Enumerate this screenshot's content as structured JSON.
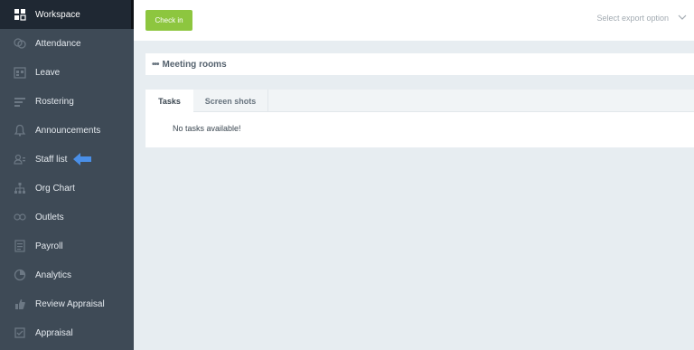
{
  "sidebar": {
    "items": [
      {
        "label": "Workspace",
        "icon": "workspace-icon",
        "active": true
      },
      {
        "label": "Attendance",
        "icon": "attendance-icon"
      },
      {
        "label": "Leave",
        "icon": "leave-icon"
      },
      {
        "label": "Rostering",
        "icon": "rostering-icon"
      },
      {
        "label": "Announcements",
        "icon": "bell-icon"
      },
      {
        "label": "Staff list",
        "icon": "staff-icon"
      },
      {
        "label": "Org Chart",
        "icon": "org-chart-icon"
      },
      {
        "label": "Outlets",
        "icon": "outlets-icon"
      },
      {
        "label": "Payroll",
        "icon": "payroll-icon"
      },
      {
        "label": "Analytics",
        "icon": "analytics-icon"
      },
      {
        "label": "Review Appraisal",
        "icon": "review-appraisal-icon"
      },
      {
        "label": "Appraisal",
        "icon": "appraisal-icon"
      }
    ],
    "pointer_arrow_color": "#4a8fe7"
  },
  "header": {
    "checkin_label": "Check in",
    "export_placeholder": "Select export option"
  },
  "rooms": {
    "title": "Meeting rooms"
  },
  "tabs": [
    {
      "label": "Tasks",
      "active": true
    },
    {
      "label": "Screen shots"
    }
  ],
  "tasks": {
    "empty_message": "No tasks available!"
  },
  "colors": {
    "sidebar_bg": "#3e4a56",
    "sidebar_active_bg": "#1f2833",
    "accent_green": "#8dc63f",
    "page_bg": "#e7edf1"
  }
}
